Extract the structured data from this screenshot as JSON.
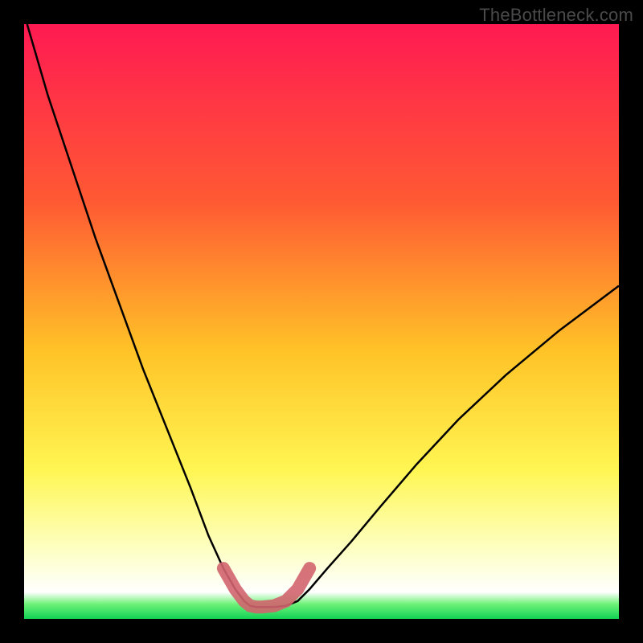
{
  "watermark": "TheBottleneck.com",
  "chart_data": {
    "type": "line",
    "title": "",
    "xlabel": "",
    "ylabel": "",
    "xlim": [
      0,
      100
    ],
    "ylim": [
      0,
      100
    ],
    "gradient_stops": [
      {
        "offset": 0.0,
        "color": "#ff1a52"
      },
      {
        "offset": 0.3,
        "color": "#ff5a33"
      },
      {
        "offset": 0.55,
        "color": "#ffc327"
      },
      {
        "offset": 0.75,
        "color": "#fff653"
      },
      {
        "offset": 0.88,
        "color": "#fdffc0"
      },
      {
        "offset": 0.955,
        "color": "#ffffff"
      },
      {
        "offset": 0.975,
        "color": "#6ff279"
      },
      {
        "offset": 1.0,
        "color": "#11d155"
      }
    ],
    "series": [
      {
        "name": "bottleneck-curve",
        "x": [
          0.5,
          4,
          8,
          12,
          16,
          20,
          24,
          28,
          31,
          33.5,
          35.5,
          37,
          38,
          39,
          40,
          42,
          44,
          46,
          48,
          51,
          55,
          60,
          66,
          73,
          81,
          90,
          100
        ],
        "y": [
          100,
          88,
          76,
          64,
          53,
          42,
          32,
          22,
          14,
          8.5,
          5,
          3,
          2.2,
          2,
          2,
          2,
          2.2,
          3,
          5,
          8.5,
          13,
          19,
          26,
          33.5,
          41,
          48.5,
          56
        ]
      }
    ],
    "highlight_band": {
      "name": "optimal-zone-marker",
      "color": "#d1646e",
      "x": [
        33.5,
        35.5,
        37,
        38,
        39,
        40,
        42,
        44,
        46,
        48
      ],
      "y": [
        8.5,
        5,
        3,
        2.2,
        2,
        2,
        2.2,
        3,
        5,
        8.5
      ]
    }
  }
}
